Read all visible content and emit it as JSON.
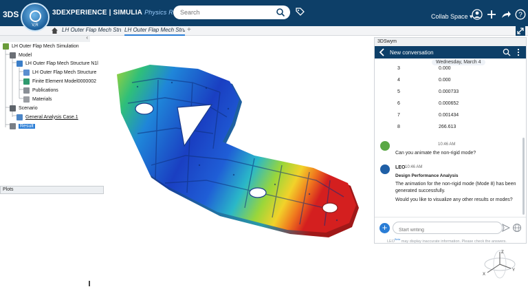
{
  "brand": {
    "logo": "3DS",
    "title_prefix": "3DEXPERIENCE | SIMULIA",
    "role": "Physics Results Explorer",
    "compass_label": "V,R"
  },
  "search": {
    "placeholder": "Search"
  },
  "header": {
    "space": "Collab Space",
    "icons": [
      "tag-icon",
      "user-icon",
      "add-icon",
      "share-icon",
      "help-icon"
    ]
  },
  "tabs": [
    {
      "label": "LH Outer Flap Mech Structure"
    },
    {
      "label": "LH Outer Flap Mech Structure"
    }
  ],
  "tree": {
    "root": "LH Outer Flap Mech Simulation",
    "model": "Model",
    "structure_n1": "LH Outer Flap Mech Structure N1l",
    "structure": "LH Outer Flap Mech Structure",
    "fem": "Finite Element Model0000002",
    "publications": "Publications",
    "materials": "Materials",
    "scenario": "Scenario",
    "case": "General Analysis Case.1",
    "result": "Result"
  },
  "plots_label": "Plots",
  "chat": {
    "panel_title": "3DSwym",
    "header": "New conversation",
    "date": "Wednesday, March 4",
    "modes": [
      {
        "n": "3",
        "v": "0.000"
      },
      {
        "n": "4",
        "v": "0.000"
      },
      {
        "n": "5",
        "v": "0.000733"
      },
      {
        "n": "6",
        "v": "0.000652"
      },
      {
        "n": "7",
        "v": "0.001434"
      },
      {
        "n": "8",
        "v": "266.613"
      }
    ],
    "user_time": "10:46 AM",
    "user_msg": "Can you animate the non-rigid mode?",
    "leo_name": "LEO",
    "leo_time": "10:46 AM",
    "leo_heading": "Design Performance Analysis",
    "leo_msg1": "The animation for the non-rigid mode (Mode 8) has been generated successfully.",
    "leo_msg2": "Would you like to visualize any other results or modes?",
    "input_placeholder": "Start writing",
    "disclaimer_leo": "LEO",
    "disclaimer_beta": "Beta",
    "disclaimer": "may display inaccurate information. Please check the answers."
  },
  "axes": {
    "x": "X",
    "y": "Y",
    "z": "Z"
  },
  "colors": {
    "topbar": "#0d3f68",
    "accent": "#2a7dd6",
    "leo": "#1f5fa6",
    "user": "#5aa845"
  }
}
